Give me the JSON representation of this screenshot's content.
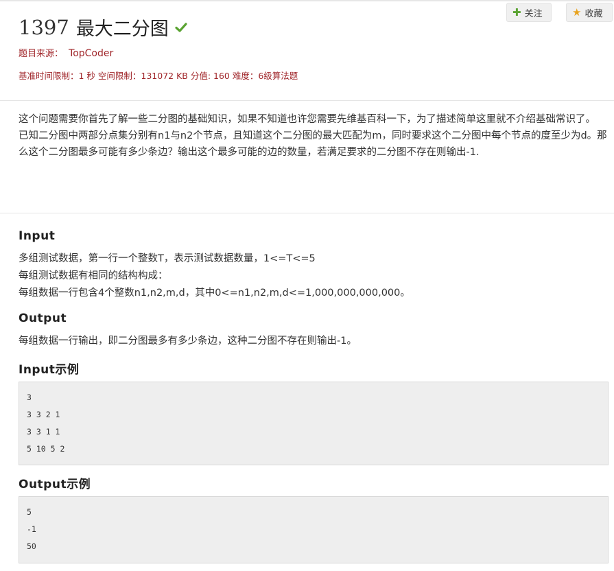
{
  "problem": {
    "id": "1397",
    "name": "最大二分图",
    "source_label": "题目来源：",
    "source_value": "TopCoder",
    "limits": "基准时间限制：1 秒 空间限制：131072 KB 分值: 160 难度：6级算法题"
  },
  "actions": {
    "follow_label": "关注",
    "collect_label": "收藏"
  },
  "description": {
    "para1": "这个问题需要你首先了解一些二分图的基础知识，如果不知道也许您需要先维基百科一下，为了描述简单这里就不介绍基础常识了。",
    "para2": "已知二分图中两部分点集分别有n1与n2个节点，且知道这个二分图的最大匹配为m，同时要求这个二分图中每个节点的度至少为d。那么这个二分图最多可能有多少条边？输出这个最多可能的边的数量，若满足要求的二分图不存在则输出-1."
  },
  "input_section": {
    "title": "Input",
    "lines": [
      "多组测试数据，第一行一个整数T，表示测试数据数量，1<=T<=5",
      "每组测试数据有相同的结构构成：",
      "每组数据一行包含4个整数n1,n2,m,d，其中0<=n1,n2,m,d<=1,000,000,000,000。"
    ]
  },
  "output_section": {
    "title": "Output",
    "text": "每组数据一行输出，即二分图最多有多少条边，这种二分图不存在则输出-1。"
  },
  "input_example": {
    "title": "Input示例",
    "lines": [
      "3",
      "3 3 2 1",
      "3 3 1 1",
      "5 10 5 2"
    ]
  },
  "output_example": {
    "title": "Output示例",
    "lines": [
      "5",
      "-1",
      "50"
    ]
  },
  "colors": {
    "accent_red": "#a0262a",
    "check_green": "#5aa332",
    "code_bg": "#eeeeee"
  },
  "icons": {
    "accepted": "check-icon",
    "follow": "plus-icon",
    "collect": "star-icon"
  }
}
